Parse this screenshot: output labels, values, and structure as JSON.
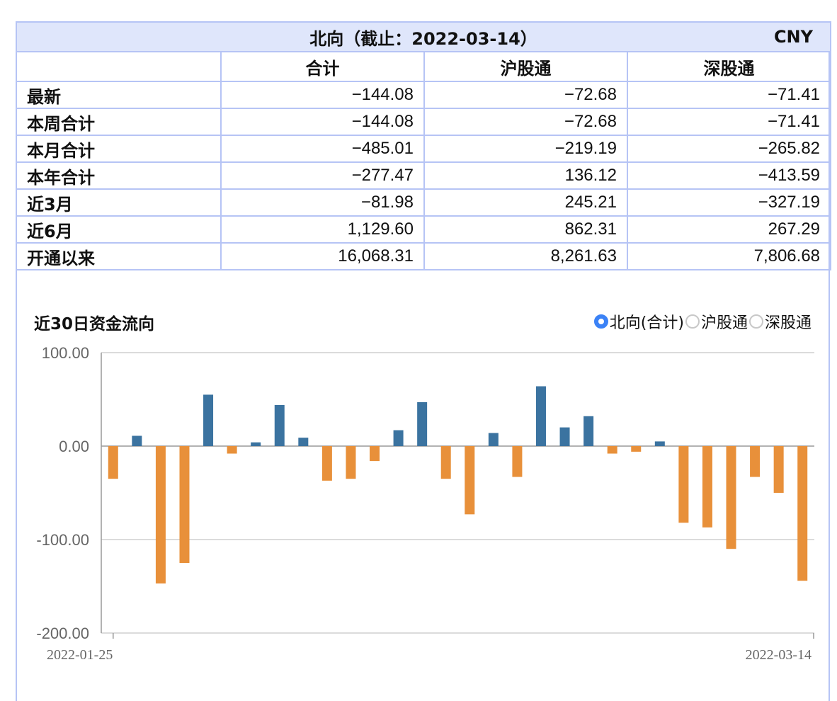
{
  "table": {
    "title": "北向（截止：2022-03-14）",
    "currency": "CNY",
    "columns": [
      "合计",
      "沪股通",
      "深股通"
    ],
    "rows": [
      {
        "label": "最新",
        "values": [
          "−144.08",
          "−72.68",
          "−71.41"
        ]
      },
      {
        "label": "本周合计",
        "values": [
          "−144.08",
          "−72.68",
          "−71.41"
        ]
      },
      {
        "label": "本月合计",
        "values": [
          "−485.01",
          "−219.19",
          "−265.82"
        ]
      },
      {
        "label": "本年合计",
        "values": [
          "−277.47",
          "136.12",
          "−413.59"
        ]
      },
      {
        "label": "近3月",
        "values": [
          "−81.98",
          "245.21",
          "−327.19"
        ]
      },
      {
        "label": "近6月",
        "values": [
          "1,129.60",
          "862.31",
          "267.29"
        ]
      },
      {
        "label": "开通以来",
        "values": [
          "16,068.31",
          "8,261.63",
          "7,806.68"
        ]
      }
    ]
  },
  "chart_title": "近30日资金流向",
  "legend": {
    "options": [
      "北向(合计)",
      "沪股通",
      "深股通"
    ],
    "selected": "北向(合计)"
  },
  "colors": {
    "positive": "#3b73a0",
    "negative": "#e8903a",
    "radio_on": "#3b82f6",
    "table_border": "#b6c4f5",
    "header_bg": "#dfe6fb"
  },
  "chart_data": {
    "type": "bar",
    "ylim": [
      -200,
      100
    ],
    "yticks": [
      "100.00",
      "0.00",
      "-100.00",
      "-200.00"
    ],
    "ytick_values": [
      100,
      0,
      -100,
      -200
    ],
    "x_labels": [
      "2022-01-25",
      "2022-03-14"
    ],
    "grid": true,
    "series": [
      {
        "values": [
          -35,
          11,
          -147,
          -125,
          55,
          -8,
          4,
          44,
          9,
          -37,
          -35,
          -16,
          17,
          47,
          -35,
          -73,
          14,
          -33,
          64,
          20,
          32,
          -8,
          -6,
          5,
          -82,
          -87,
          -110,
          -33,
          -50,
          -144.08
        ]
      }
    ]
  }
}
